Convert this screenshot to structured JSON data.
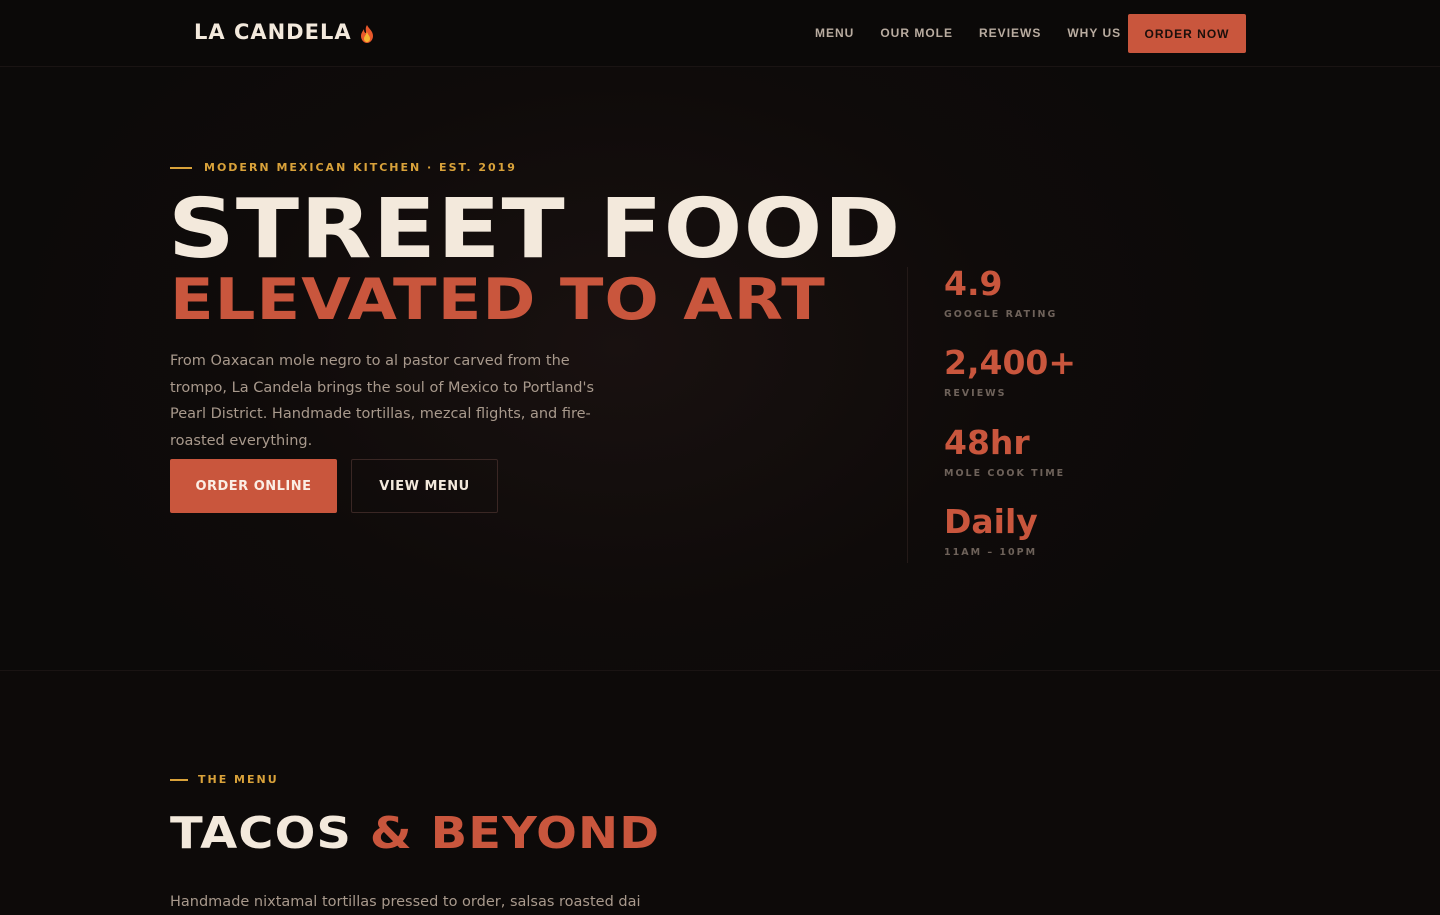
{
  "nav": {
    "brand": "LA CANDELA",
    "brand_icon": "flame-icon",
    "links": [
      "MENU",
      "OUR MOLE",
      "REVIEWS",
      "WHY US"
    ],
    "cta": "ORDER NOW"
  },
  "hero": {
    "eyebrow": "MODERN MEXICAN KITCHEN · EST. 2019",
    "headline_1": "STREET FOOD",
    "headline_2": "ELEVATED TO ART",
    "lead": "From Oaxacan mole negro to al pastor carved from the trompo, La Candela brings the soul of Mexico to Portland's Pearl District. Handmade tortillas, mezcal flights, and fire-roasted everything.",
    "primary_button": "ORDER ONLINE",
    "secondary_button": "VIEW MENU",
    "stats": [
      {
        "value": "4.9",
        "label": "GOOGLE RATING"
      },
      {
        "value": "2,400+",
        "label": "REVIEWS"
      },
      {
        "value": "48hr",
        "label": "MOLE COOK TIME"
      },
      {
        "value": "Daily",
        "label": "11AM – 10PM"
      }
    ]
  },
  "menu_section": {
    "eyebrow": "THE MENU",
    "title_1": "TACOS",
    "title_2": "& BEYOND",
    "lead": "Handmade nixtamal tortillas pressed to order, salsas roasted daily on"
  },
  "colors": {
    "accent": "#c9563d",
    "gold": "#d9a23a",
    "cream": "#f3e9dc",
    "background": "#0d0a09"
  }
}
